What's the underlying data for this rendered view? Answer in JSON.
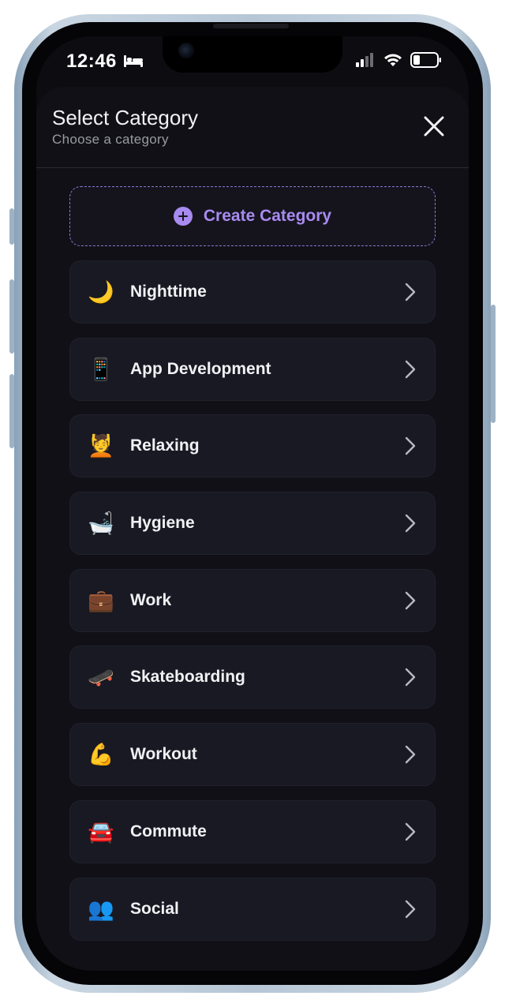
{
  "status_bar": {
    "time": "12:46",
    "icons": [
      "bed-icon",
      "cellular-signal-icon",
      "wifi-icon",
      "battery-icon"
    ]
  },
  "header": {
    "title": "Select Category",
    "subtitle": "Choose a category",
    "close_icon": "close-icon"
  },
  "create_button": {
    "label": "Create Category",
    "icon": "plus-circle-icon"
  },
  "categories": [
    {
      "label": "Nighttime",
      "emoji": "🌙",
      "icon": "crescent-moon-icon"
    },
    {
      "label": "App Development",
      "emoji": "📱",
      "icon": "mobile-phone-icon"
    },
    {
      "label": "Relaxing",
      "emoji": "💆",
      "icon": "face-massage-icon"
    },
    {
      "label": "Hygiene",
      "emoji": "🛁",
      "icon": "bathtub-icon"
    },
    {
      "label": "Work",
      "emoji": "💼",
      "icon": "briefcase-icon"
    },
    {
      "label": "Skateboarding",
      "emoji": "🛹",
      "icon": "skateboard-icon"
    },
    {
      "label": "Workout",
      "emoji": "💪",
      "icon": "flexed-biceps-icon"
    },
    {
      "label": "Commute",
      "emoji": "🚘",
      "icon": "car-icon"
    },
    {
      "label": "Social",
      "emoji": "👥",
      "icon": "people-icon"
    }
  ],
  "colors": {
    "accent": "#a88bf0",
    "sheet_background": "#101016",
    "row_background": "#181923"
  }
}
